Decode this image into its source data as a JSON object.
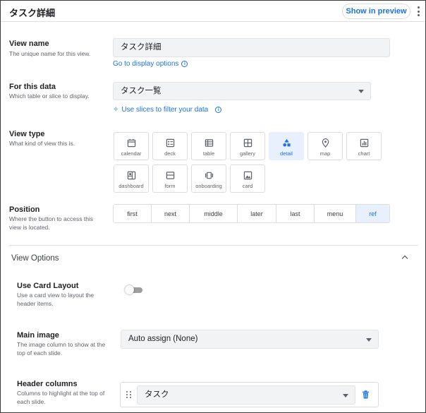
{
  "header": {
    "title": "タスク詳細",
    "preview_label": "Show in preview"
  },
  "view_name": {
    "label": "View name",
    "description": "The unique name for this view.",
    "value": "タスク詳細",
    "link_label": "Go to display options"
  },
  "for_this_data": {
    "label": "For this data",
    "description": "Which table or slice to display.",
    "selected": "タスク一覧",
    "link_label": "Use slices to filter your data"
  },
  "view_type": {
    "label": "View type",
    "description": "What kind of view this is.",
    "selected": "detail",
    "options": [
      {
        "label": "calendar",
        "icon": "calendar-icon"
      },
      {
        "label": "deck",
        "icon": "deck-icon"
      },
      {
        "label": "table",
        "icon": "table-icon"
      },
      {
        "label": "gallery",
        "icon": "gallery-icon"
      },
      {
        "label": "detail",
        "icon": "detail-icon"
      },
      {
        "label": "map",
        "icon": "map-pin-icon"
      },
      {
        "label": "chart",
        "icon": "chart-icon"
      },
      {
        "label": "dashboard",
        "icon": "dashboard-icon"
      },
      {
        "label": "form",
        "icon": "form-icon"
      },
      {
        "label": "onboarding",
        "icon": "onboarding-icon"
      },
      {
        "label": "card",
        "icon": "card-icon"
      }
    ]
  },
  "position": {
    "label": "Position",
    "description": "Where the button to access this view is located.",
    "selected": "ref",
    "options": [
      "first",
      "next",
      "middle",
      "later",
      "last",
      "menu",
      "ref"
    ]
  },
  "view_options": {
    "title": "View Options",
    "use_card_layout": {
      "label": "Use Card Layout",
      "description": "Use a card view to layout the header items.",
      "enabled": false
    },
    "main_image": {
      "label": "Main image",
      "description": "The image column to show at the top of each slide.",
      "selected": "Auto assign (None)"
    },
    "header_columns": {
      "label": "Header columns",
      "description": "Columns to highlight at the top of each slide.",
      "items": [
        "タスク"
      ]
    }
  },
  "colors": {
    "accent": "#1a73e8",
    "selected_bg": "#e8f0fe",
    "input_bg": "#f1f3f4",
    "delete": "#1a73e8"
  }
}
